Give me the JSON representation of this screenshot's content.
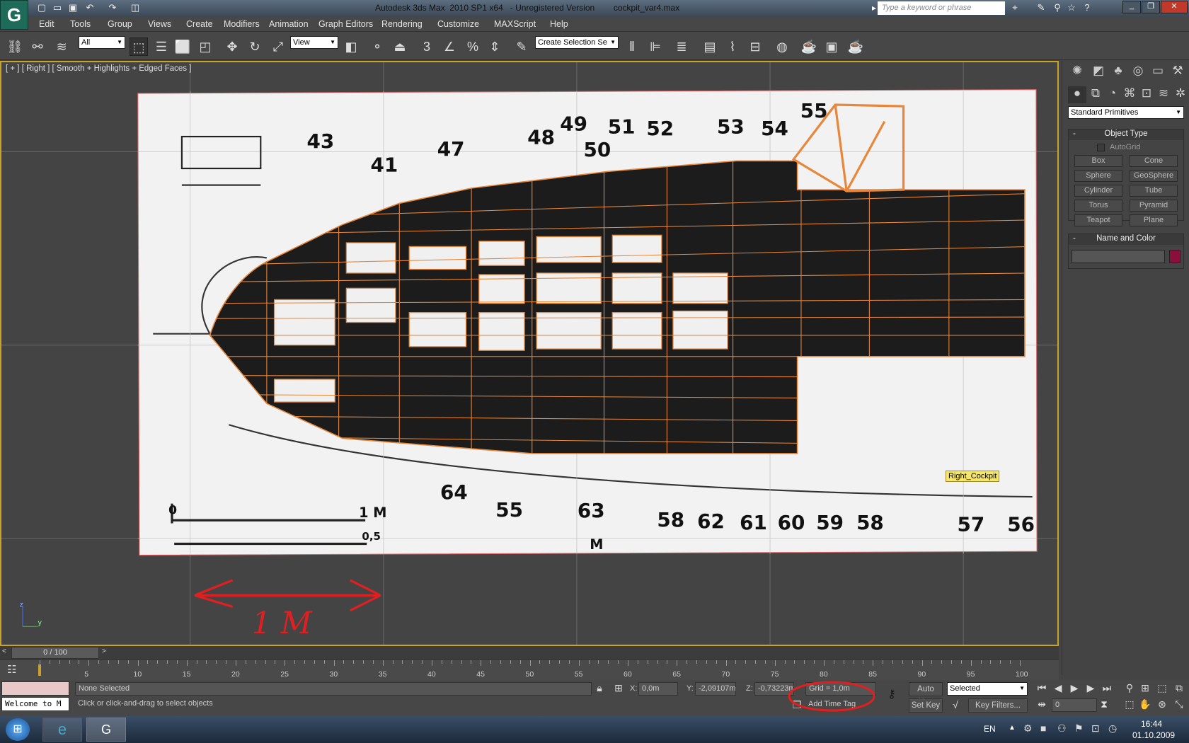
{
  "window": {
    "title": "Autodesk 3ds Max  2010 SP1 x64   - Unregistered Version        cockpit_var4.max",
    "search_placeholder": "Type a keyword or phrase"
  },
  "menu": [
    "Edit",
    "Tools",
    "Group",
    "Views",
    "Create",
    "Modifiers",
    "Animation",
    "Graph Editors",
    "Rendering",
    "Customize",
    "MAXScript",
    "Help"
  ],
  "toolbar": {
    "filter": "All",
    "ref_coord": "View",
    "selection_set": "Create Selection Se"
  },
  "viewport": {
    "label": "[ + ] [ Right ] [ Smooth + Highlights + Edged Faces ]",
    "object_tooltip": "Right_Cockpit",
    "annotation": "1 M",
    "blueprint": {
      "labels": [
        "43",
        "41",
        "47",
        "48",
        "49",
        "50",
        "51",
        "52",
        "53",
        "54",
        "55",
        "64",
        "55",
        "63",
        "58",
        "62",
        "61",
        "60",
        "59",
        "58",
        "57",
        "56"
      ],
      "scale_1m": "1 M",
      "scale_half": "0,5",
      "scale_zero": "0",
      "letter_m": "M"
    },
    "axis": {
      "z": "z",
      "y": "y"
    }
  },
  "command_panel": {
    "category": "Standard Primitives",
    "object_type_title": "Object Type",
    "autogrid": "AutoGrid",
    "buttons": [
      "Box",
      "Cone",
      "Sphere",
      "GeoSphere",
      "Cylinder",
      "Tube",
      "Torus",
      "Pyramid",
      "Teapot",
      "Plane"
    ],
    "name_color_title": "Name and Color",
    "object_color": "#8b0f3c"
  },
  "timeslider": {
    "position": "0 / 100",
    "ticks": [
      "5",
      "10",
      "15",
      "20",
      "25",
      "30",
      "35",
      "40",
      "45",
      "50",
      "55",
      "60",
      "65",
      "70",
      "75",
      "80",
      "85",
      "90",
      "95",
      "100"
    ]
  },
  "status": {
    "listener": "Welcome to M",
    "selection": "None Selected",
    "prompt": "Click or click-and-drag to select objects",
    "x_label": "X:",
    "x": "0,0m",
    "y_label": "Y:",
    "y": "-2,09107m",
    "z_label": "Z:",
    "z": "-0,73223m",
    "grid": "Grid = 1,0m",
    "add_time_tag": "Add Time Tag",
    "auto_key": "Auto Key",
    "key_mode": "Selected",
    "set_key": "Set Key",
    "key_filters": "Key Filters...",
    "frame": "0"
  },
  "taskbar": {
    "language": "EN",
    "time": "16:44",
    "date": "01.10.2009"
  }
}
